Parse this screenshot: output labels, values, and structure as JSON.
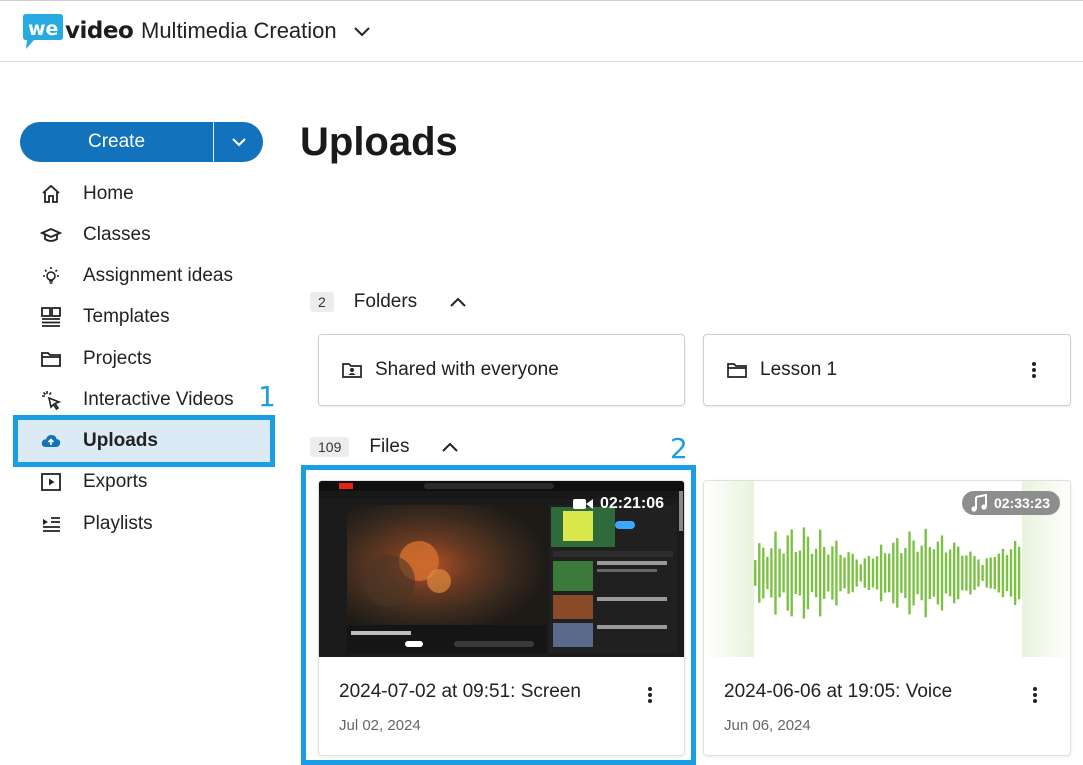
{
  "header": {
    "logo_we": "we",
    "logo_video": "video",
    "workspace": "Multimedia Creation"
  },
  "sidebar": {
    "create_label": "Create",
    "items": [
      {
        "label": "Home",
        "icon": "home-icon"
      },
      {
        "label": "Classes",
        "icon": "classes-icon"
      },
      {
        "label": "Assignment ideas",
        "icon": "lightbulb-icon"
      },
      {
        "label": "Templates",
        "icon": "templates-icon"
      },
      {
        "label": "Projects",
        "icon": "folder-icon"
      },
      {
        "label": "Interactive Videos",
        "icon": "cursor-click-icon"
      },
      {
        "label": "Uploads",
        "icon": "cloud-upload-icon",
        "active": true
      },
      {
        "label": "Exports",
        "icon": "play-box-icon"
      },
      {
        "label": "Playlists",
        "icon": "playlist-icon"
      }
    ]
  },
  "annotations": {
    "one": "1",
    "two": "2"
  },
  "main": {
    "title": "Uploads",
    "folders": {
      "count": "2",
      "label": "Folders",
      "items": [
        {
          "name": "Shared with everyone",
          "icon": "shared-folder-icon"
        },
        {
          "name": "Lesson 1",
          "icon": "folder-icon"
        }
      ]
    },
    "files": {
      "count": "109",
      "label": "Files",
      "items": [
        {
          "title": "2024-07-02 at 09:51: Screen",
          "date": "Jul 02, 2024",
          "duration": "02:21:06",
          "kind": "video"
        },
        {
          "title": "2024-06-06 at 19:05: Voice",
          "date": "Jun 06, 2024",
          "duration": "02:33:23",
          "kind": "audio"
        }
      ]
    }
  },
  "colors": {
    "accent": "#1272bb",
    "annotation": "#1a9ee2",
    "active_bg": "#dbeaf5",
    "waveform": "#7cc242"
  }
}
